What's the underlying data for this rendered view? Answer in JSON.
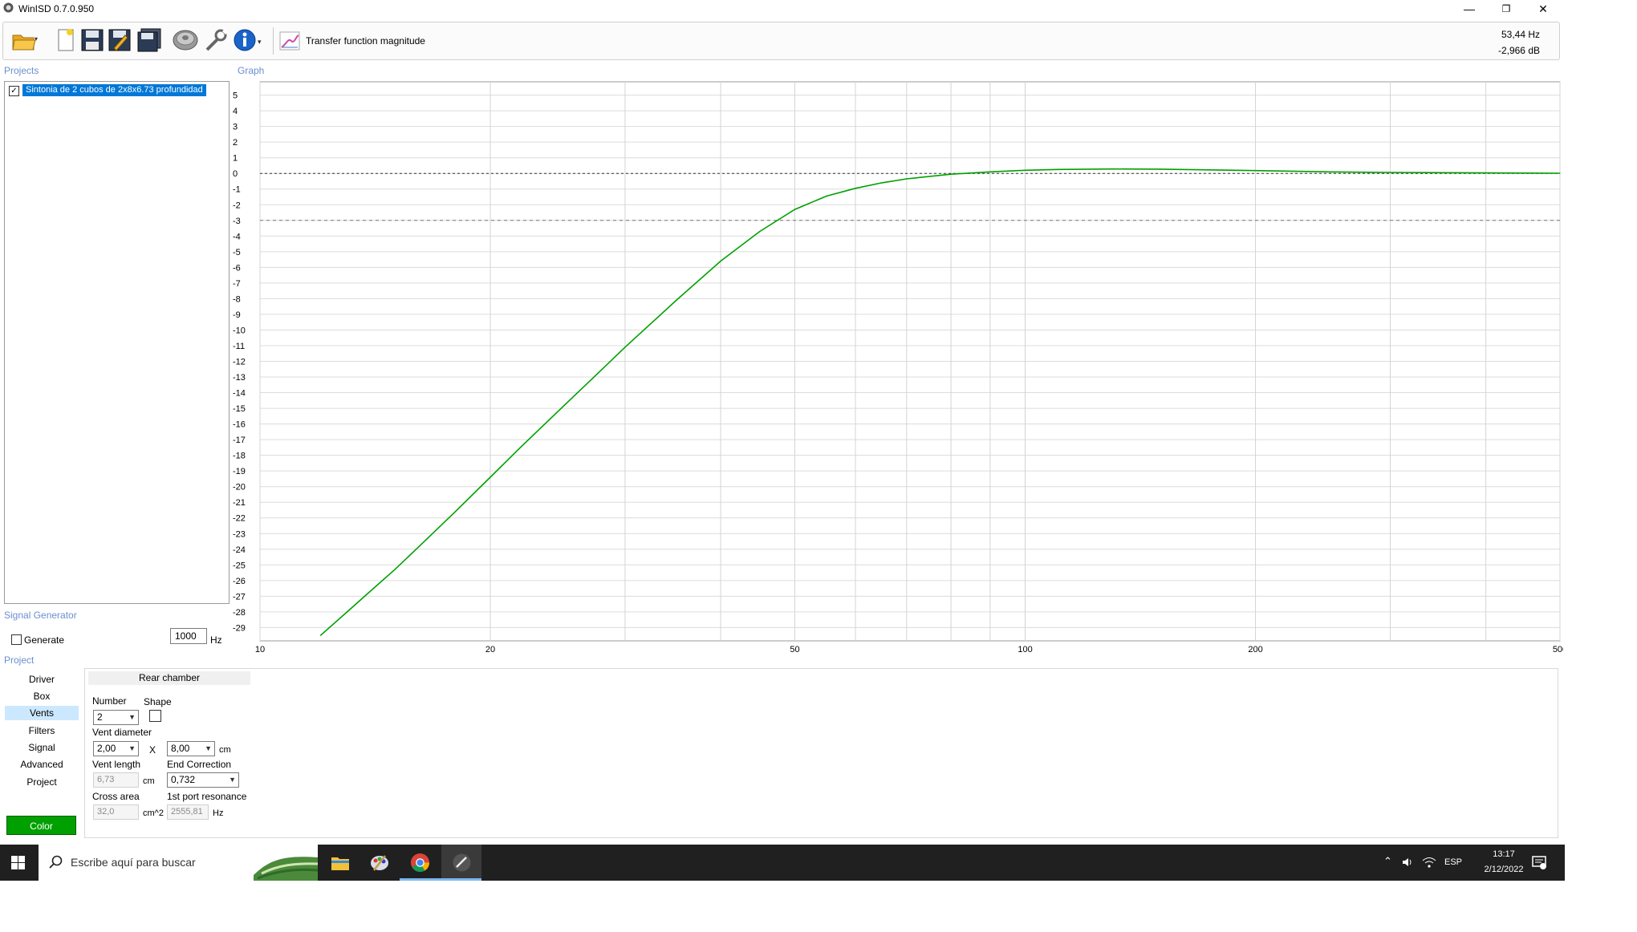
{
  "window": {
    "title": "WinISD 0.7.0.950",
    "minimize": "—",
    "restore": "❐",
    "close": "✕"
  },
  "toolbar": {
    "graph_type_label": "Transfer function magnitude",
    "readout_freq": "53,44 Hz",
    "readout_db": "-2,966 dB"
  },
  "projects": {
    "section_label": "Projects",
    "items": [
      {
        "name": "Sintonia de 2 cubos de 2x8x6.73 profundidad",
        "checked": true
      }
    ]
  },
  "graph": {
    "section_label": "Graph"
  },
  "chart_data": {
    "type": "line",
    "xscale": "log",
    "xlim": [
      10,
      500
    ],
    "ylim": [
      -30,
      6
    ],
    "x_ticks": [
      "10",
      "20",
      "50",
      "100",
      "200",
      "500"
    ],
    "y_ticks": [
      "5",
      "4",
      "3",
      "2",
      "1",
      "0",
      "-1",
      "-2",
      "-3",
      "-4",
      "-5",
      "-6",
      "-7",
      "-8",
      "-9",
      "-10",
      "-11",
      "-12",
      "-13",
      "-14",
      "-15",
      "-16",
      "-17",
      "-18",
      "-19",
      "-20",
      "-21",
      "-22",
      "-23",
      "-24",
      "-25",
      "-26",
      "-27",
      "-28",
      "-29"
    ],
    "reference_lines": [
      0,
      -3
    ],
    "grid": true,
    "series": [
      {
        "color": "#00a000",
        "x": [
          12,
          13,
          14,
          15,
          16,
          18,
          20,
          22,
          25,
          28,
          30,
          35,
          40,
          45,
          50,
          55,
          60,
          65,
          70,
          80,
          90,
          100,
          110,
          130,
          150,
          200,
          250,
          300,
          400,
          500
        ],
        "y": [
          -29.5,
          -28,
          -26.6,
          -25.3,
          -24,
          -21.6,
          -19.4,
          -17.4,
          -14.8,
          -12.5,
          -11.1,
          -8.1,
          -5.6,
          -3.7,
          -2.3,
          -1.45,
          -0.95,
          -0.6,
          -0.35,
          -0.05,
          0.1,
          0.2,
          0.25,
          0.28,
          0.27,
          0.18,
          0.1,
          0.06,
          0.03,
          0.01
        ]
      }
    ]
  },
  "signal_generator": {
    "section_label": "Signal Generator",
    "generate_label": "Generate",
    "frequency": "1000",
    "unit": "Hz"
  },
  "project_nav": {
    "section_label": "Project",
    "items": [
      {
        "label": "Driver",
        "active": false
      },
      {
        "label": "Box",
        "active": false
      },
      {
        "label": "Vents",
        "active": true
      },
      {
        "label": "Filters",
        "active": false
      },
      {
        "label": "Signal",
        "active": false
      },
      {
        "label": "Advanced",
        "active": false
      },
      {
        "label": "Project",
        "active": false
      }
    ],
    "color_button": "Color",
    "color_value": "#00a000"
  },
  "vents": {
    "header": "Rear chamber",
    "number_label": "Number",
    "number_value": "2",
    "shape_label": "Shape",
    "diameter_label": "Vent diameter",
    "diameter_value": "2,00",
    "x_sep": "X",
    "diameter_value2": "8,00",
    "diameter_unit": "cm",
    "length_label": "Vent length",
    "length_value": "6,73",
    "length_unit": "cm",
    "end_correction_label": "End Correction",
    "end_correction_value": "0,732",
    "cross_area_label": "Cross area",
    "cross_area_value": "32,0",
    "cross_area_unit": "cm^2",
    "port_resonance_label": "1st port resonance",
    "port_resonance_value": "2555,81",
    "port_resonance_unit": "Hz"
  },
  "taskbar": {
    "search_placeholder": "Escribe aquí para buscar",
    "language": "ESP",
    "time": "13:17",
    "date": "2/12/2022"
  }
}
